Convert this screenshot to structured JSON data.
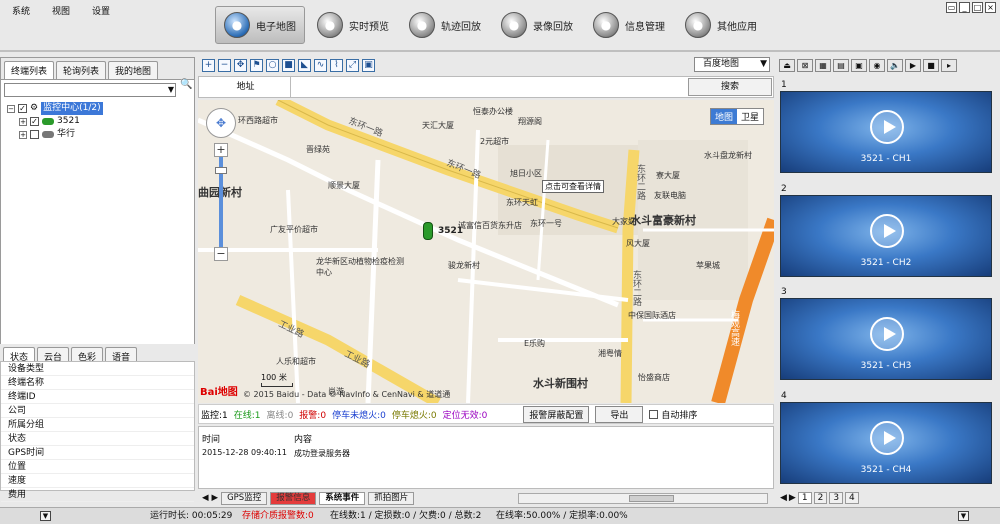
{
  "menu": {
    "system": "系统",
    "view": "视图",
    "settings": "设置"
  },
  "nav": [
    {
      "label": "电子地图",
      "icon": "globe-icon"
    },
    {
      "label": "实时预览",
      "icon": "camera-icon"
    },
    {
      "label": "轨迹回放",
      "icon": "track-icon"
    },
    {
      "label": "录像回放",
      "icon": "film-icon"
    },
    {
      "label": "信息管理",
      "icon": "info-icon"
    },
    {
      "label": "其他应用",
      "icon": "gear-icon"
    }
  ],
  "left": {
    "tabs": [
      "终端列表",
      "轮询列表",
      "我的地图"
    ],
    "tree_root": "监控中心(1/2)",
    "tree_items": [
      "3521",
      "华行"
    ],
    "status_tabs": [
      "状态",
      "云台",
      "色彩",
      "语音"
    ],
    "status_fields": [
      "设备类型",
      "终端名称",
      "终端ID",
      "公司",
      "所属分组",
      "状态",
      "GPS时间",
      "位置",
      "速度",
      "费用"
    ]
  },
  "map": {
    "maptype": "百度地图",
    "address_label": "地址",
    "search_label": "搜索",
    "mode_map": "地图",
    "mode_satellite": "卫星",
    "tooltip": "点击可查看详情",
    "vehicle_label": "3521",
    "scale": "100 米",
    "logo": "Bai地图",
    "copyright": "© 2015 Baidu - Data © NavInfo & CenNavi & 道道通",
    "labels": [
      "恒泰办公楼",
      "天汇大厦",
      "翔源阁",
      "2元超市",
      "旭日小区",
      "东环天虹",
      "诚富信百货东升店",
      "东环一号",
      "大家好",
      "风大厦",
      "友联电脑",
      "水斗盘龙新村",
      "顺景大厦",
      "晋绿苑",
      "环西路超市",
      "广友平价超市",
      "龙华新区动植物检疫检测中心",
      "骏龙新村",
      "中保国际酒店",
      "E乐购",
      "湘粤情",
      "怡盛商店",
      "人乐和超市",
      "尚游",
      "苹果城",
      "寮大厦"
    ],
    "big_labels": [
      "水斗富豪新村",
      "水斗新围村",
      "曲园新村"
    ],
    "road_labels": [
      "东环一路",
      "东环一路",
      "东环二路",
      "东环二路",
      "工业路",
      "工业路",
      "梅观高速"
    ]
  },
  "monitor": {
    "items": [
      {
        "text": "监控:1",
        "color": "#000000"
      },
      {
        "text": "在线:1",
        "color": "#1a9a1a"
      },
      {
        "text": "离线:0",
        "color": "#888888"
      },
      {
        "text": "报警:0",
        "color": "#d00000"
      },
      {
        "text": "停车未熄火:0",
        "color": "#1a3fd0"
      },
      {
        "text": "停车熄火:0",
        "color": "#7a7a00"
      },
      {
        "text": "定位无效:0",
        "color": "#9a00c0"
      }
    ],
    "alarm_config": "报警屏蔽配置",
    "export": "导出",
    "auto_sort": "自动排序"
  },
  "events": {
    "headers": [
      "时间",
      "内容"
    ],
    "rows": [
      {
        "time": "2015-12-28 09:40:11",
        "content": "成功登录服务器"
      }
    ],
    "tabs": [
      "GPS监控",
      "报警信息",
      "系统事件",
      "抓拍图片"
    ]
  },
  "video": {
    "cells": [
      {
        "num": "1",
        "channel": "3521 - CH1"
      },
      {
        "num": "2",
        "channel": "3521 - CH2"
      },
      {
        "num": "3",
        "channel": "3521 - CH3"
      },
      {
        "num": "4",
        "channel": "3521 - CH4"
      }
    ],
    "pages": [
      "1",
      "2",
      "3",
      "4"
    ]
  },
  "status": {
    "runtime": "运行时长: 00:05:29",
    "storage": "存储介质报警数:0",
    "online": "在线数:1 / 定损数:0 / 欠费:0 / 总数:2",
    "rate": "在线率:50.00% / 定损率:0.00%"
  },
  "colors": {
    "accent": "#3d7bd4",
    "alarm": "#e43b3b",
    "video_bg": "#3a78c6"
  }
}
